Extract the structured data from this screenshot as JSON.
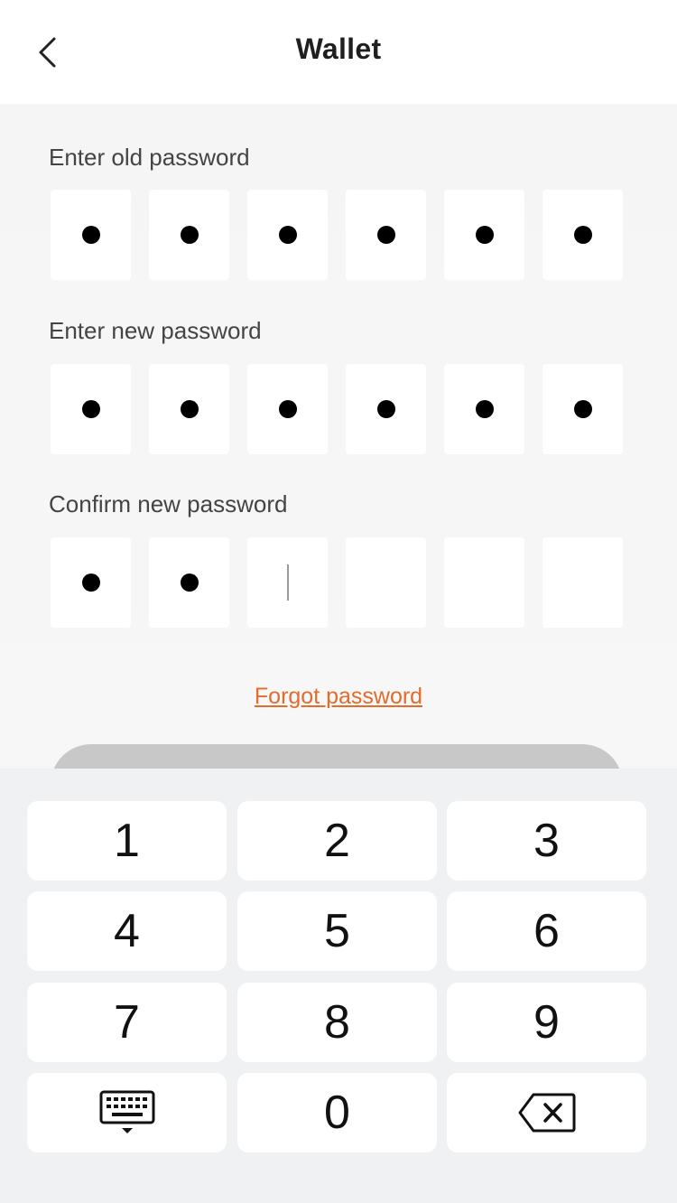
{
  "header": {
    "title": "Wallet",
    "back_icon": "chevron-left-icon"
  },
  "old_password": {
    "label": "Enter old password",
    "length": 6,
    "filled": 6
  },
  "new_password": {
    "label": "Enter new password",
    "length": 6,
    "filled": 6
  },
  "confirm_password": {
    "label": "Confirm new password",
    "length": 6,
    "filled": 2,
    "cursor_index": 2
  },
  "forgot_link": "Forgot password",
  "submit_button": {
    "state": "disabled",
    "color": "#c8c8c8"
  },
  "keypad": {
    "keys": [
      "1",
      "2",
      "3",
      "4",
      "5",
      "6",
      "7",
      "8",
      "9"
    ],
    "zero": "0",
    "hide_icon": "keyboard-hide-icon",
    "delete_icon": "backspace-icon"
  },
  "colors": {
    "accent": "#e36b2c",
    "keypad_bg": "#f0f1f3"
  }
}
